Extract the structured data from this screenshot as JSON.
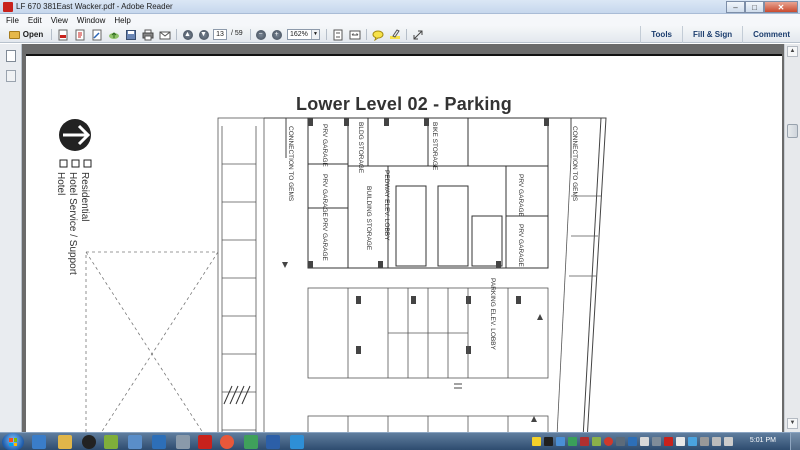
{
  "window": {
    "title": "LF 670  381East Wacker.pdf - Adobe Reader",
    "min_label": "–",
    "max_label": "□",
    "close_label": "✕"
  },
  "menu": [
    "File",
    "Edit",
    "View",
    "Window",
    "Help"
  ],
  "toolbar": {
    "open_label": "Open",
    "page_current": "13",
    "page_total": "/ 59",
    "zoom": "162%",
    "tools_label": "Tools",
    "fill_sign_label": "Fill & Sign",
    "comment_label": "Comment"
  },
  "document": {
    "plan_title": "Lower Level 02 - Parking",
    "legend": [
      "Residential",
      "Hotel Service / Support",
      "Hotel"
    ],
    "labels": {
      "connection_left": "CONNECTION TO GEMS",
      "connection_right": "CONNECTION TO GEMS",
      "prv_garage": "PRV GARAGE",
      "bldg_storage": "BLDG STORAGE",
      "bike_storage": "BIKE STORAGE",
      "building_storage": "BUILDING STORAGE",
      "pedway_lobby": "PEDWAY ELEV. LOBBY",
      "parking_lobby": "PARKING ELEV. LOBBY"
    }
  },
  "taskbar": {
    "clock": "5:01 PM"
  },
  "colors": {
    "reader_red": "#c8221c",
    "taskbar": "#2e4c6f",
    "doc_bg": "#6b6b6b"
  }
}
